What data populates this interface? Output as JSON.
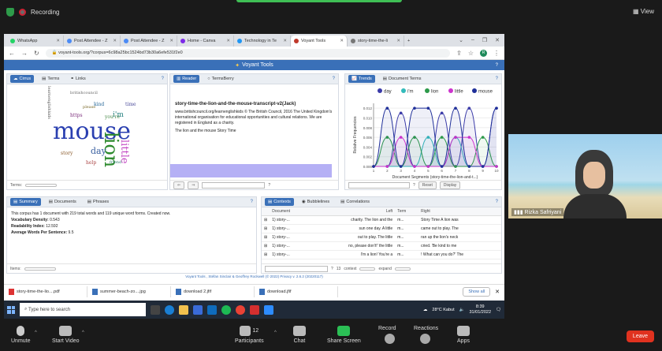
{
  "zoom_top": {
    "recording_label": "Recording",
    "view_label": "View"
  },
  "browser": {
    "tabs": [
      {
        "label": "WhatsApp",
        "active": false
      },
      {
        "label": "Post Attendee - Z",
        "active": false
      },
      {
        "label": "Post Attendee - Z",
        "active": false
      },
      {
        "label": "Home - Canva",
        "active": false
      },
      {
        "label": "Technology in Te",
        "active": false
      },
      {
        "label": "Voyant Tools",
        "active": true
      },
      {
        "label": "story-time-the-li",
        "active": false
      }
    ],
    "url": "voyant-tools.org/?corpus=6c98a25bc1524bd73b30a6efe531f2e0",
    "avatar_letter": "R"
  },
  "voyant": {
    "title": "Voyant Tools",
    "cirrus_panel": {
      "tabs": [
        "Cirrus",
        "Terms",
        "Links"
      ],
      "footer_label": "Terms:",
      "words": [
        {
          "text": "mouse",
          "color": "#2a3fb0"
        },
        {
          "text": "lion",
          "color": "#2d8a2d"
        },
        {
          "text": "little",
          "color": "#c54ec5"
        },
        {
          "text": "day",
          "color": "#3a60a0"
        },
        {
          "text": "i'm",
          "color": "#1e7d7d"
        },
        {
          "text": "story",
          "color": "#8a5a2a"
        },
        {
          "text": "https",
          "color": "#7a2a7a"
        },
        {
          "text": "you're",
          "color": "#4a8a4a"
        },
        {
          "text": "learnenglishkids",
          "color": "#555555"
        },
        {
          "text": "britishcouncil",
          "color": "#666666"
        },
        {
          "text": "kind",
          "color": "#2a6a9a"
        },
        {
          "text": "help",
          "color": "#aa4444"
        },
        {
          "text": "time",
          "color": "#4a4a9a"
        },
        {
          "text": "please",
          "color": "#7a6a2a"
        },
        {
          "text": "friend",
          "color": "#2a7a6a"
        }
      ]
    },
    "reader_panel": {
      "tabs": [
        "Reader",
        "TermsBerry"
      ],
      "doc_title": "story-time-the-lion-and-the-mouse-transcript-v2(Jack)",
      "paragraphs": [
        "www.britishcouncil.org/learnenglishkids © The British Council, 2016 The United Kingdom's international organisation for educational opportunities and cultural relations. We are registered in England as a charity.",
        "The lion and the mouse Story Time"
      ]
    },
    "trends_panel": {
      "tabs": [
        "Trends",
        "Document Terms"
      ],
      "footer_buttons": [
        "Reset",
        "Display"
      ]
    },
    "summary_panel": {
      "tabs": [
        "Summary",
        "Documents",
        "Phrases"
      ],
      "intro": "This corpus has 1 document with 219 total words and 119 unique word forms. Created now.",
      "vocab_label": "Vocabulary Density:",
      "vocab_value": "0.543",
      "readability_label": "Readability Index:",
      "readability_value": "12.592",
      "avg_label": "Average Words Per Sentence:",
      "avg_value": "9.5",
      "footer_label": "Items:"
    },
    "contexts_panel": {
      "tabs": [
        "Contexts",
        "Bubblelines",
        "Correlations"
      ],
      "columns": [
        "Document",
        "Left",
        "Term",
        "Right"
      ],
      "rows": [
        {
          "doc": "1) story-...",
          "left": "charity. The lion and the",
          "term": "m...",
          "right": "Story Time A lion was"
        },
        {
          "doc": "1) story-...",
          "left": "sun one day. A little",
          "term": "m...",
          "right": "came out to play. The"
        },
        {
          "doc": "1) story-...",
          "left": "out to play. The little",
          "term": "m...",
          "right": "ran up the lion's neck"
        },
        {
          "doc": "1) story-...",
          "left": "no, please don't!' the little",
          "term": "m...",
          "right": "cried. 'Be kind to me"
        },
        {
          "doc": "1) story-...",
          "left": "I'm a lion! You're a",
          "term": "m...",
          "right": "! What can you do?' The"
        }
      ],
      "context_label": "context",
      "context_value": "13",
      "expand_label": "expand"
    },
    "credits": "Voyant Tools , Stéfan Sinclair & Geoffrey Rockwell (© 2022) Privacy v. 2.6.2 (20220117)"
  },
  "chart_data": {
    "type": "line",
    "title": "",
    "xlabel": "Document Segments (story-time-the-lion-and-t...)",
    "ylabel": "Relative Frequencies",
    "x": [
      1,
      2,
      3,
      4,
      5,
      6,
      7,
      8,
      9,
      10
    ],
    "ylim": [
      0,
      0.013
    ],
    "yticks": [
      "0.000",
      "0.002",
      "0.004",
      "0.006",
      "0.008",
      "0.010",
      "0.012"
    ],
    "legend_position": "top",
    "series": [
      {
        "name": "day",
        "color": "#3a3aa8",
        "values": [
          0,
          0,
          0.011,
          0,
          0,
          0.011,
          0,
          0.012,
          0,
          0.012
        ]
      },
      {
        "name": "i'm",
        "color": "#33bbbb",
        "values": [
          0,
          0,
          0,
          0,
          0.006,
          0,
          0.006,
          0,
          0,
          0
        ]
      },
      {
        "name": "lion",
        "color": "#2d9a4a",
        "values": [
          0,
          0.006,
          0,
          0.006,
          0,
          0.006,
          0,
          0,
          0.006,
          0
        ]
      },
      {
        "name": "little",
        "color": "#cc33cc",
        "values": [
          0,
          0,
          0.006,
          0,
          0,
          0,
          0.006,
          0.006,
          0,
          0
        ]
      },
      {
        "name": "mouse",
        "color": "#1f2f99",
        "values": [
          0,
          0.012,
          0,
          0.012,
          0.012,
          0,
          0.012,
          0,
          0,
          0.012
        ]
      }
    ]
  },
  "downloads": {
    "items": [
      {
        "name": "story-time-the-lio....pdf",
        "type": "pdf"
      },
      {
        "name": "summer-beach-zo....jpg",
        "type": "img"
      },
      {
        "name": "download 2.jfif",
        "type": "img"
      },
      {
        "name": "download.jfif",
        "type": "img"
      }
    ],
    "show_all": "Show all"
  },
  "taskbar": {
    "search_placeholder": "Type here to search",
    "weather": "28°C Kabut",
    "time": "8:39",
    "date": "31/01/2022"
  },
  "video": {
    "participant_name": "Rizka Safriyani"
  },
  "zoom_bar": {
    "unmute": "Unmute",
    "start_video": "Start Video",
    "participants": "Participants",
    "participants_count": "12",
    "chat": "Chat",
    "share_screen": "Share Screen",
    "record": "Record",
    "reactions": "Reactions",
    "apps": "Apps",
    "leave": "Leave"
  }
}
